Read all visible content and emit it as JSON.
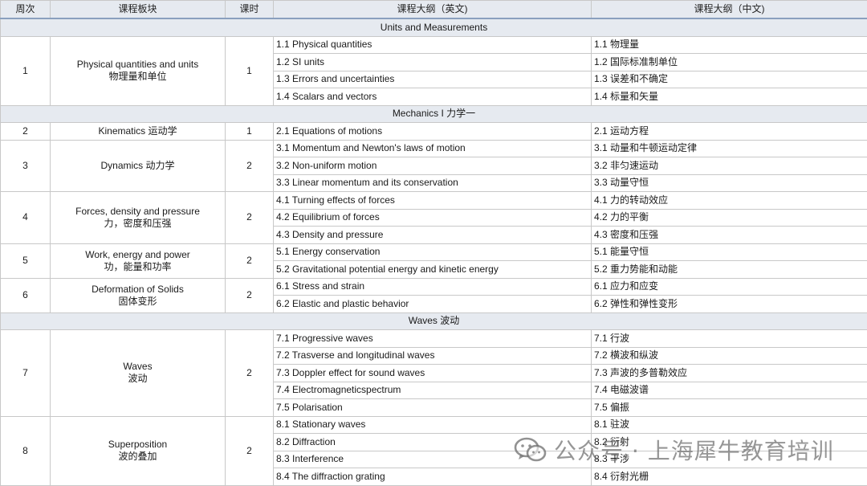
{
  "headers": {
    "week": "周次",
    "module": "课程板块",
    "hours": "课时",
    "outline_en": "课程大纲（英文)",
    "outline_zh": "课程大纲（中文)"
  },
  "sections": [
    {
      "title": "Units and Measurements",
      "weeks": [
        {
          "week": "1",
          "module_en": "Physical quantities and units",
          "module_zh": "物理量和单位",
          "hours": "1",
          "topics": [
            {
              "en": "1.1 Physical quantities",
              "zh": "1.1 物理量"
            },
            {
              "en": "1.2 SI units",
              "zh": "1.2 国际标准制单位"
            },
            {
              "en": "1.3 Errors and uncertainties",
              "zh": "1.3 误差和不确定"
            },
            {
              "en": "1.4 Scalars and vectors",
              "zh": "1.4 标量和矢量"
            }
          ]
        }
      ]
    },
    {
      "title": "Mechanics I 力学一",
      "weeks": [
        {
          "week": "2",
          "module_en": "Kinematics 运动学",
          "module_zh": "",
          "hours": "1",
          "topics": [
            {
              "en": "2.1 Equations of motions",
              "zh": "2.1 运动方程"
            }
          ]
        },
        {
          "week": "3",
          "module_en": "Dynamics 动力学",
          "module_zh": "",
          "hours": "2",
          "topics": [
            {
              "en": "3.1 Momentum and Newton's laws of motion",
              "zh": "3.1 动量和牛顿运动定律"
            },
            {
              "en": "3.2 Non-uniform motion",
              "zh": "3.2 非匀速运动"
            },
            {
              "en": "3.3 Linear momentum and its conservation",
              "zh": "3.3 动量守恒"
            }
          ]
        },
        {
          "week": "4",
          "module_en": "Forces, density and pressure",
          "module_zh": "力，密度和压强",
          "hours": "2",
          "topics": [
            {
              "en": "4.1 Turning effects of forces",
              "zh": "4.1 力的转动效应"
            },
            {
              "en": "4.2 Equilibrium of forces",
              "zh": "4.2 力的平衡"
            },
            {
              "en": "4.3 Density and pressure",
              "zh": "4.3 密度和压强"
            }
          ]
        },
        {
          "week": "5",
          "module_en": "Work, energy and power",
          "module_zh": "功，能量和功率",
          "hours": "2",
          "topics": [
            {
              "en": "5.1 Energy conservation",
              "zh": "5.1 能量守恒"
            },
            {
              "en": "5.2 Gravitational potential energy and kinetic energy",
              "zh": "5.2 重力势能和动能"
            }
          ]
        },
        {
          "week": "6",
          "module_en": "Deformation of Solids",
          "module_zh": "固体变形",
          "hours": "2",
          "topics": [
            {
              "en": "6.1 Stress and strain",
              "zh": "6.1 应力和应变"
            },
            {
              "en": "6.2 Elastic and plastic behavior",
              "zh": "6.2 弹性和弹性变形"
            }
          ]
        }
      ]
    },
    {
      "title": "Waves 波动",
      "weeks": [
        {
          "week": "7",
          "module_en": "Waves",
          "module_zh": "波动",
          "hours": "2",
          "topics": [
            {
              "en": "7.1 Progressive waves",
              "zh": "7.1 行波"
            },
            {
              "en": "7.2 Trasverse and longitudinal waves",
              "zh": "7.2 横波和纵波"
            },
            {
              "en": "7.3 Doppler effect for sound waves",
              "zh": "7.3 声波的多普勒效应"
            },
            {
              "en": "7.4 Electromagneticspectrum",
              "zh": "7.4 电磁波谱"
            },
            {
              "en": "7.5 Polarisation",
              "zh": "7.5 偏振"
            }
          ]
        },
        {
          "week": "8",
          "module_en": "Superposition",
          "module_zh": "波的叠加",
          "hours": "2",
          "topics": [
            {
              "en": "8.1 Stationary waves",
              "zh": "8.1 驻波"
            },
            {
              "en": "8.2 Diffraction",
              "zh": "8.2 衍射"
            },
            {
              "en": "8.3 Interference",
              "zh": "8.3 干涉"
            },
            {
              "en": "8.4 The diffraction grating",
              "zh": "8.4 衍射光栅"
            }
          ]
        }
      ]
    }
  ],
  "watermark": {
    "text": "公众号 · 上海犀牛教育培训",
    "icon": "wechat-icon"
  }
}
